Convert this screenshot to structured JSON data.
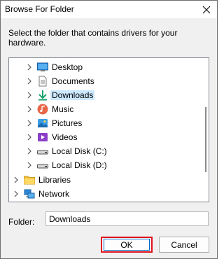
{
  "window": {
    "title": "Browse For Folder"
  },
  "instruction": "Select the folder that contains drivers for your hardware.",
  "tree": {
    "items": [
      {
        "label": "Desktop",
        "icon": "desktop-icon",
        "level": 1
      },
      {
        "label": "Documents",
        "icon": "documents-icon",
        "level": 1
      },
      {
        "label": "Downloads",
        "icon": "downloads-icon",
        "level": 1,
        "selected": true
      },
      {
        "label": "Music",
        "icon": "music-icon",
        "level": 1
      },
      {
        "label": "Pictures",
        "icon": "pictures-icon",
        "level": 1
      },
      {
        "label": "Videos",
        "icon": "videos-icon",
        "level": 1
      },
      {
        "label": "Local Disk (C:)",
        "icon": "drive-icon",
        "level": 1
      },
      {
        "label": "Local Disk (D:)",
        "icon": "drive-icon",
        "level": 1
      },
      {
        "label": "Libraries",
        "icon": "libraries-icon",
        "level": 0
      },
      {
        "label": "Network",
        "icon": "network-icon",
        "level": 0
      }
    ]
  },
  "folder": {
    "label": "Folder:",
    "value": "Downloads"
  },
  "buttons": {
    "ok": "OK",
    "cancel": "Cancel"
  },
  "colors": {
    "selection": "#cce8ff",
    "highlight_border": "#e0141e",
    "accent": "#0067c0"
  }
}
